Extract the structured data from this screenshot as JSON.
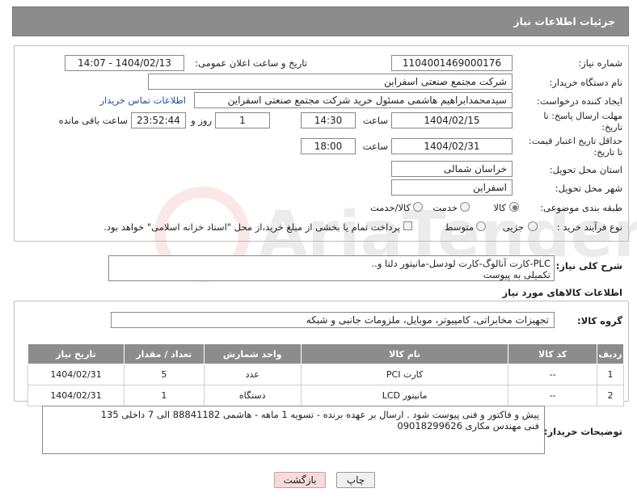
{
  "header": {
    "title": "جزئیات اطلاعات نیاز"
  },
  "info": {
    "need_number_label": "شماره نیاز:",
    "need_number": "1104001469000176",
    "announce_label": "تاریخ و ساعت اعلان عمومی:",
    "announce_value": "1404/02/13 - 14:07",
    "buyer_org_label": "نام دستگاه خریدار:",
    "buyer_org": "شرکت مجتمع صنعتی اسفراین",
    "creator_label": "ایجاد کننده درخواست:",
    "creator": "سیدمحمدابراهیم هاشمی مسئول خرید شرکت مجتمع صنعتی اسفراین",
    "contact_link": "اطلاعات تماس خریدار",
    "deadline_label_1": "مهلت ارسال پاسخ: تا",
    "deadline_label_2": "تاریخ:",
    "deadline_date": "1404/02/15",
    "time_label": "ساعت",
    "deadline_time": "14:30",
    "days_value": "1",
    "days_label": "روز و",
    "remaining_value": "23:52:44",
    "remaining_label": "ساعت باقی مانده",
    "price_label_1": "حداقل تاریخ اعتبار قیمت:",
    "price_label_2": "تا تاریخ:",
    "price_date": "1404/02/31",
    "price_time": "18:00",
    "province_label": "استان محل تحویل:",
    "province": "خراسان شمالی",
    "city_label": "شهر محل تحویل:",
    "city": "اسفراین",
    "category_label": "طبقه بندی موضوعی:",
    "category_options": [
      "کالا",
      "خدمت",
      "کالا/خدمت"
    ],
    "process_label": "نوع فرآیند خرید :",
    "process_options": [
      "جزیی",
      "متوسط"
    ],
    "payment_note": "پرداخت تمام یا بخشی از مبلغ خرید،از محل \"اسناد خزانه اسلامی\" خواهد بود."
  },
  "description": {
    "label": "شرح کلی نیاز:",
    "line1": "PLC-کارت آنالوگ-کارت لودسل-مانیتور دلتا و..",
    "line2": "تکمیلی به پیوست"
  },
  "goods": {
    "section_title": "اطلاعات کالاهای مورد نیاز",
    "group_label": "گروه کالا:",
    "group_value": "تجهیزات مخابراتی، کامپیوتر، موبایل، ملزومات جانبی و شبکه",
    "columns": [
      "ردیف",
      "کد کالا",
      "نام کالا",
      "واحد شمارش",
      "تعداد / مقدار",
      "تاریخ نیاز"
    ],
    "rows": [
      [
        "1",
        "--",
        "کارت PCI",
        "عدد",
        "5",
        "1404/02/31"
      ],
      [
        "2",
        "--",
        "مانیتور LCD",
        "دستگاه",
        "1",
        "1404/02/31"
      ]
    ]
  },
  "notes": {
    "label": "توضیحات خریدار:",
    "line1": "پیش و فاکتور و فنی پیوست شود . ارسال بر عهده برنده - تسویه 1 ماهه - هاشمی 88841182 الی 7 داخلی 135",
    "line2": "فنی مهندس مکاری 09018299626"
  },
  "buttons": {
    "print": "چاپ",
    "back": "بازگشت"
  },
  "watermark": {
    "text": "AriaTender.neT"
  }
}
